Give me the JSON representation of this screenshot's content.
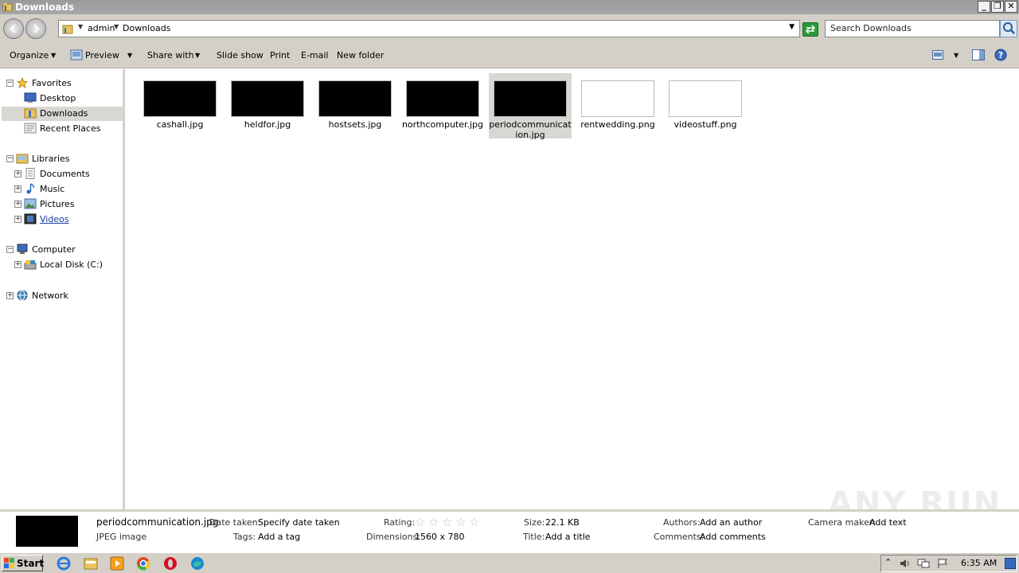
{
  "window": {
    "title": "Downloads",
    "minimize_label": "_",
    "maximize_label": "❐",
    "close_label": "✕"
  },
  "address": {
    "crumbs": [
      "admin",
      "Downloads"
    ],
    "search_placeholder": "Search Downloads"
  },
  "toolbar": {
    "organize": "Organize",
    "preview": "Preview",
    "share_with": "Share with",
    "slide_show": "Slide show",
    "print": "Print",
    "email": "E-mail",
    "new_folder": "New folder"
  },
  "nav": {
    "favorites": "Favorites",
    "desktop": "Desktop",
    "downloads": "Downloads",
    "recent_places": "Recent Places",
    "libraries": "Libraries",
    "documents": "Documents",
    "music": "Music",
    "pictures": "Pictures",
    "videos": "Videos",
    "computer": "Computer",
    "local_disk": "Local Disk (C:)",
    "network": "Network"
  },
  "files": [
    {
      "name": "cashall.jpg",
      "thumb_color": "#000000"
    },
    {
      "name": "heldfor.jpg",
      "thumb_color": "#000000"
    },
    {
      "name": "hostsets.jpg",
      "thumb_color": "#000000"
    },
    {
      "name": "northcomputer.jpg",
      "thumb_color": "#000000"
    },
    {
      "name": "periodcommunication.jpg",
      "thumb_color": "#000000",
      "selected": true
    },
    {
      "name": "rentwedding.png",
      "thumb_color": "#ffffff"
    },
    {
      "name": "videostuff.png",
      "thumb_color": "#ffffff"
    }
  ],
  "details": {
    "filename": "periodcommunication.jpg",
    "filetype": "JPEG image",
    "date_taken_label": "Date taken:",
    "date_taken_value": "Specify date taken",
    "tags_label": "Tags:",
    "tags_value": "Add a tag",
    "rating_label": "Rating:",
    "rating": 0,
    "dimensions_label": "Dimensions:",
    "dimensions_value": "1560 x 780",
    "size_label": "Size:",
    "size_value": "22.1 KB",
    "title_label": "Title:",
    "title_value": "Add a title",
    "authors_label": "Authors:",
    "authors_value": "Add an author",
    "comments_label": "Comments:",
    "comments_value": "Add comments",
    "camera_label": "Camera maker:",
    "camera_value": "Add text"
  },
  "taskbar": {
    "start": "Start",
    "clock": "6:35 AM"
  },
  "watermark": "ANY RUN",
  "colors": {
    "chrome": "#d4d0c8",
    "selection": "#d9d7d1",
    "titlebar": "#a0a0a0"
  }
}
